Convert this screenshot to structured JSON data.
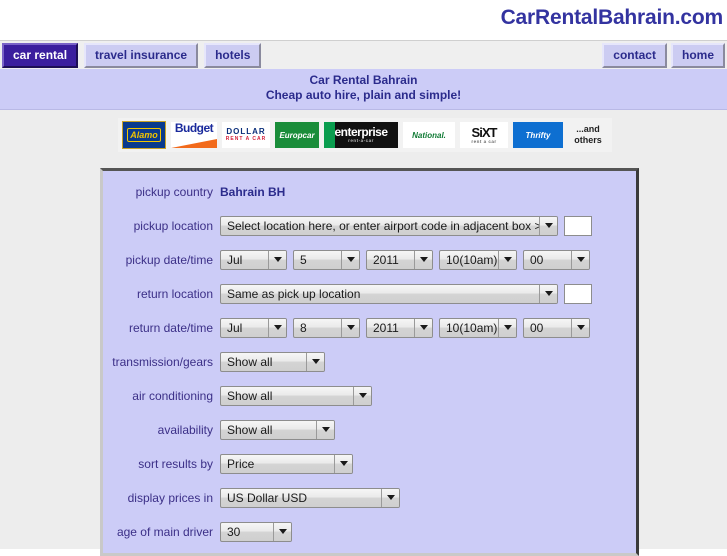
{
  "header": {
    "brand": "CarRentalBahrain.com"
  },
  "nav": {
    "left": [
      {
        "label": "car rental",
        "active": true
      },
      {
        "label": "travel insurance",
        "active": false
      },
      {
        "label": "hotels",
        "active": false
      }
    ],
    "right": [
      {
        "label": "contact"
      },
      {
        "label": "home"
      }
    ]
  },
  "tagline": {
    "line1": "Car Rental Bahrain",
    "line2": "Cheap auto hire, plain and simple!"
  },
  "logos": [
    {
      "name": "alamo",
      "text": "Alamo"
    },
    {
      "name": "budget",
      "text": "Budget"
    },
    {
      "name": "dollar",
      "text": "DOLLAR",
      "sub": "RENT A CAR"
    },
    {
      "name": "europcar",
      "text": "Europcar"
    },
    {
      "name": "enterprise",
      "text": "enterprise",
      "sub": "rent-a-car"
    },
    {
      "name": "national",
      "text": "National."
    },
    {
      "name": "sixt",
      "text": "SiXT",
      "sub": "rent a car"
    },
    {
      "name": "thrifty",
      "text": "Thrifty"
    },
    {
      "name": "and-others",
      "line1": "...and",
      "line2": "others"
    }
  ],
  "form": {
    "pickup_country": {
      "label": "pickup country",
      "value": "Bahrain BH"
    },
    "pickup_location": {
      "label": "pickup location",
      "value": "Select location here, or enter airport code in adjacent box >",
      "code_value": ""
    },
    "pickup_datetime": {
      "label": "pickup date/time",
      "month": "Jul",
      "day": "5",
      "year": "2011",
      "hour": "10(10am):",
      "minute": "00"
    },
    "return_location": {
      "label": "return location",
      "value": "Same as pick up location",
      "code_value": ""
    },
    "return_datetime": {
      "label": "return date/time",
      "month": "Jul",
      "day": "8",
      "year": "2011",
      "hour": "10(10am):",
      "minute": "00"
    },
    "transmission": {
      "label": "transmission/gears",
      "value": "Show all"
    },
    "air_conditioning": {
      "label": "air conditioning",
      "value": "Show all"
    },
    "availability": {
      "label": "availability",
      "value": "Show all"
    },
    "sort_results": {
      "label": "sort results by",
      "value": "Price"
    },
    "display_prices": {
      "label": "display prices in",
      "value": "US Dollar USD"
    },
    "driver_age": {
      "label": "age of main driver",
      "value": "30"
    }
  },
  "colors": {
    "brand": "#3333a0",
    "band": "#ccccf7",
    "panel_bg": "#ccccf7",
    "active_tab": "#3b1f9e",
    "page_bg": "#ededed",
    "label_text": "#3b2f87"
  }
}
